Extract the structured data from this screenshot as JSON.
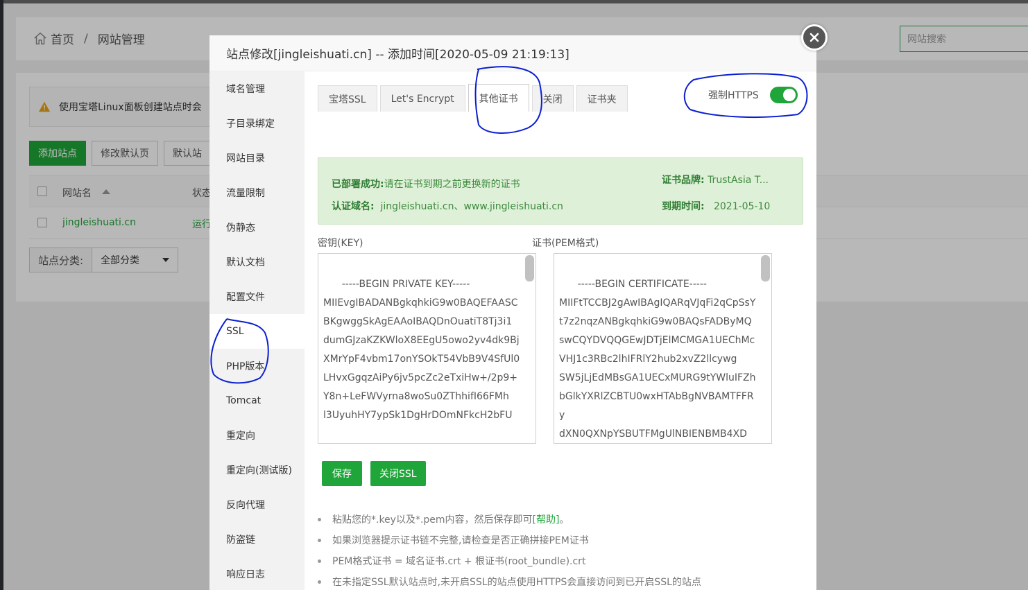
{
  "breadcrumb": {
    "home": "首页",
    "separator": "/",
    "current": "网站管理"
  },
  "search": {
    "placeholder": "网站搜索"
  },
  "notice": {
    "text": "使用宝塔Linux面板创建站点时会"
  },
  "toolbar": {
    "add_site": "添加站点",
    "modify_default": "修改默认页",
    "default_site": "默认站"
  },
  "table": {
    "columns": {
      "name": "网站名",
      "status": "状态"
    },
    "rows": [
      {
        "name": "jingleishuati.cn",
        "status": "运行"
      }
    ]
  },
  "category": {
    "label": "站点分类:",
    "selected": "全部分类"
  },
  "modal": {
    "title": "站点修改[jingleishuati.cn] -- 添加时间[2020-05-09 21:19:13]",
    "sidebar": [
      "域名管理",
      "子目录绑定",
      "网站目录",
      "流量限制",
      "伪静态",
      "默认文档",
      "配置文件",
      "SSL",
      "PHP版本",
      "Tomcat",
      "重定向",
      "重定向(测试版)",
      "反向代理",
      "防盗链",
      "响应日志"
    ],
    "tabs": [
      "宝塔SSL",
      "Let's Encrypt",
      "其他证书",
      "关闭",
      "证书夹"
    ],
    "force_https_label": "强制HTTPS",
    "force_https_on": true,
    "status": {
      "deploy_label": "已部署成功:",
      "deploy_text": "请在证书到期之前更换新的证书",
      "domain_label": "认证域名:",
      "domain_text": "jingleishuati.cn、www.jingleishuati.cn",
      "brand_label": "证书品牌:",
      "brand_text": "TrustAsia T...",
      "expire_label": "到期时间:",
      "expire_text": "2021-05-10"
    },
    "key_label": "密钥(KEY)",
    "cert_label": "证书(PEM格式)",
    "key_content": "-----BEGIN PRIVATE KEY-----\nMIIEvgIBADANBgkqhkiG9w0BAQEFAASCBKgwggSkAgEAAoIBAQDnOuatiT8Tj3i1\ndumGJzaKZKWloX8EEgU5owo2yv4dk9BjXMrYpF4vbm17onYSOkT54VbB9V4SfUl0\nLHvxGgqzAiPy6jv5pcZc2eTxiHw+/2p9+Y8n+LeFWVyrna8woSu0ZThhifI66FMh\nl3UyuhHY7ypSk1DgHrDOmNFkcH2bFU",
    "cert_content": "-----BEGIN CERTIFICATE-----\nMIIFtTCCBJ2gAwIBAgIQARqVJqFi2qCpSsYt7z2nqzANBgkqhkiG9w0BAQsFADByMQswCQYDVQQGEwJDTjElMCMGA1UEChMcVHJ1c3RBc2lhIFRlY2hub2xvZ2llcywg\nSW5jLjEdMBsGA1UECxMURG9tYWluIFZhbGlkYXRlZCBTU0wxHTAbBgNVBAMTFFRy\ndXN0QXNpYSBUTFMgUlNBIENBMB4XD",
    "save_button": "保存",
    "close_ssl_button": "关闭SSL",
    "tips": {
      "tip1_text": "粘贴您的*.key以及*.pem内容，然后保存即可",
      "tip1_help": "[帮助]",
      "tip1_end": "。",
      "tip2": "如果浏览器提示证书链不完整,请检查是否正确拼接PEM证书",
      "tip3": "PEM格式证书 = 域名证书.crt + 根证书(root_bundle).crt",
      "tip4": "在未指定SSL默认站点时,未开启SSL的站点使用HTTPS会直接访问到已开启SSL的站点"
    }
  },
  "colors": {
    "accent": "#20a53a",
    "annotation": "#0a1fd1"
  }
}
